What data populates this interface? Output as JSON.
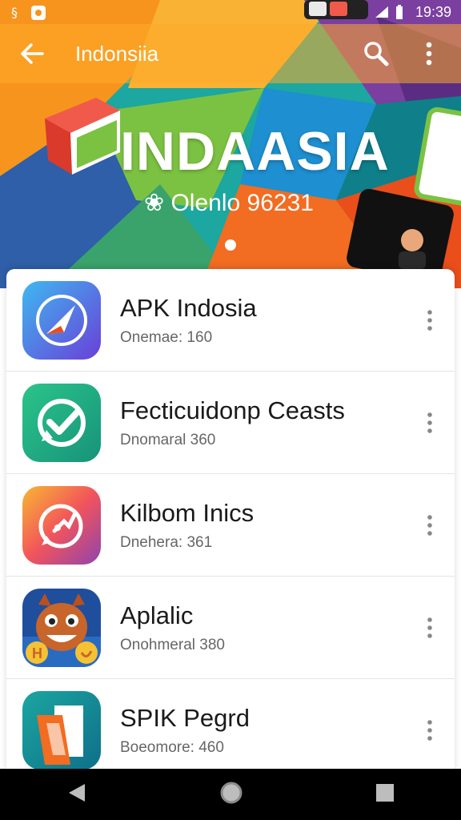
{
  "status_bar": {
    "time": "19:39"
  },
  "app_bar": {
    "title": "Indonsiia",
    "back_icon": "arrow-left-icon",
    "search_icon": "search-icon",
    "menu_icon": "more-vert-icon"
  },
  "hero": {
    "title": "INDAASIA",
    "subtitle": "❀ Olenlo 96231"
  },
  "apps": [
    {
      "name": "APK Indosia",
      "sub": "Onemae: 160",
      "icon": "compass-icon"
    },
    {
      "name": "Fecticuidonp Ceasts",
      "sub": "Dnomaral 360",
      "icon": "check-chat-icon"
    },
    {
      "name": "Kilbom Inics",
      "sub": "Dnehera: 361",
      "icon": "chat-bubble-icon"
    },
    {
      "name": "Aplalic",
      "sub": "Onohmeral 380",
      "icon": "monster-face-icon"
    },
    {
      "name": "SPIK Pegrd",
      "sub": "Boeomore: 460",
      "icon": "document-icon"
    }
  ],
  "nav": {
    "back": "back-triangle-icon",
    "home": "home-circle-icon",
    "recents": "recents-square-icon"
  },
  "colors": {
    "orange": "#F7941D",
    "teal": "#1BA6A0",
    "purple": "#7B3FA0",
    "green": "#7CC242"
  }
}
